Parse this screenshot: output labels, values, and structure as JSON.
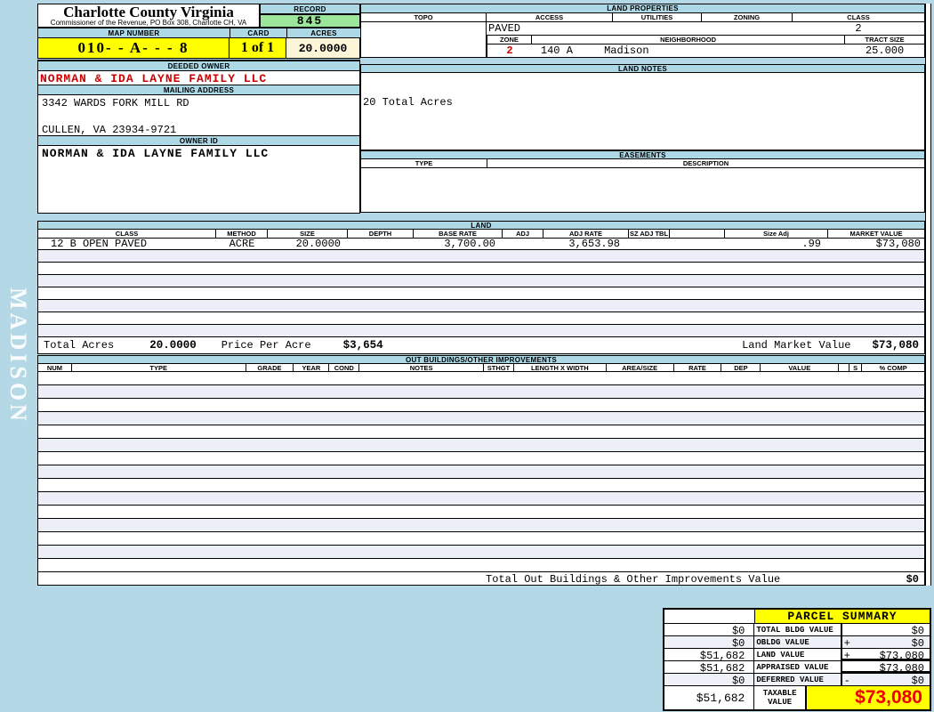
{
  "page": {
    "sidebar_label": "MADISON"
  },
  "header": {
    "county_title": "Charlotte County Virginia",
    "county_subtitle": "Commissioner of the Revenue, PO Box 308, Charlotte CH, VA",
    "record_label": "RECORD",
    "record_value": "845",
    "map_number_label": "MAP NUMBER",
    "map_number_value": "010- - A- - - 8",
    "card_label": "CARD",
    "card_value": "1 of 1",
    "acres_label": "ACRES",
    "acres_value": "20.0000"
  },
  "owner": {
    "deeded_owner_label": "DEEDED OWNER",
    "deeded_owner": "NORMAN & IDA LAYNE FAMILY LLC",
    "mailing_address_label": "MAILING ADDRESS",
    "address_line1": "3342 WARDS FORK MILL RD",
    "address_line2": "CULLEN, VA 23934-9721",
    "owner_id_label": "OWNER ID",
    "owner_id": "NORMAN & IDA LAYNE FAMILY LLC"
  },
  "land_properties": {
    "title": "LAND PROPERTIES",
    "columns": [
      "TOPO",
      "ACCESS",
      "UTILITIES",
      "ZONING",
      "CLASS"
    ],
    "access": "PAVED",
    "class": "2",
    "zone_label": "ZONE",
    "zone": "2",
    "neighborhood_label": "NEIGHBORHOOD",
    "neighborhood_code": "140 A",
    "neighborhood_name": "Madison",
    "tract_size_label": "TRACT SIZE",
    "tract_size": "25.000"
  },
  "land_notes": {
    "title": "LAND NOTES",
    "note": "20 Total Acres"
  },
  "easements": {
    "title": "EASEMENTS",
    "type_label": "TYPE",
    "description_label": "DESCRIPTION"
  },
  "land": {
    "title": "LAND",
    "columns": [
      "CLASS",
      "METHOD",
      "SIZE",
      "DEPTH",
      "BASE RATE",
      "ADJ",
      "ADJ RATE",
      "SZ ADJ TBL",
      "",
      "Size Adj",
      "MARKET VALUE"
    ],
    "rows": [
      [
        "12 B OPEN PAVED",
        "ACRE",
        "20.0000",
        "",
        "3,700.00",
        "",
        "3,653.98",
        "",
        "",
        ".99",
        "$73,080"
      ]
    ],
    "total_acres_label": "Total Acres",
    "total_acres": "20.0000",
    "price_per_acre_label": "Price Per Acre",
    "price_per_acre": "$3,654",
    "market_value_label": "Land Market Value",
    "market_value": "$73,080"
  },
  "out_buildings": {
    "title": "OUT BUILDINGS/OTHER IMPROVEMENTS",
    "columns": [
      "NUM",
      "TYPE",
      "GRADE",
      "YEAR",
      "COND",
      "NOTES",
      "STHGT",
      "LENGTH X WIDTH",
      "AREA/SIZE",
      "RATE",
      "DEP",
      "VALUE",
      "",
      "S",
      "% COMP"
    ],
    "total_label": "Total Out Buildings & Other Improvements Value",
    "total_value": "$0"
  },
  "parcel_summary": {
    "title": "PARCEL SUMMARY",
    "rows": [
      {
        "prior": "$0",
        "label": "TOTAL BLDG VALUE",
        "op": "",
        "value": "$0"
      },
      {
        "prior": "$0",
        "label": "OBLDG VALUE",
        "op": "+",
        "value": "$0"
      },
      {
        "prior": "$51,682",
        "label": "LAND VALUE",
        "op": "+",
        "value": "$73,080"
      },
      {
        "prior": "$51,682",
        "label": "APPRAISED VALUE",
        "op": "",
        "value": "$73,080"
      },
      {
        "prior": "$0",
        "label": "DEFERRED VALUE",
        "op": "-",
        "value": "$0"
      },
      {
        "prior": "$51,682",
        "label": "TAXABLE VALUE",
        "op": "",
        "value": "$73,080"
      }
    ]
  },
  "colors": {
    "header_bar": "#add8e6",
    "record_green": "#9ce69c",
    "highlight_yellow": "#ffff00",
    "acres_cream": "#fdf5d8",
    "owner_red": "#cc0000",
    "taxable_red": "#ee0000",
    "row_stripe": "#edeff8"
  }
}
